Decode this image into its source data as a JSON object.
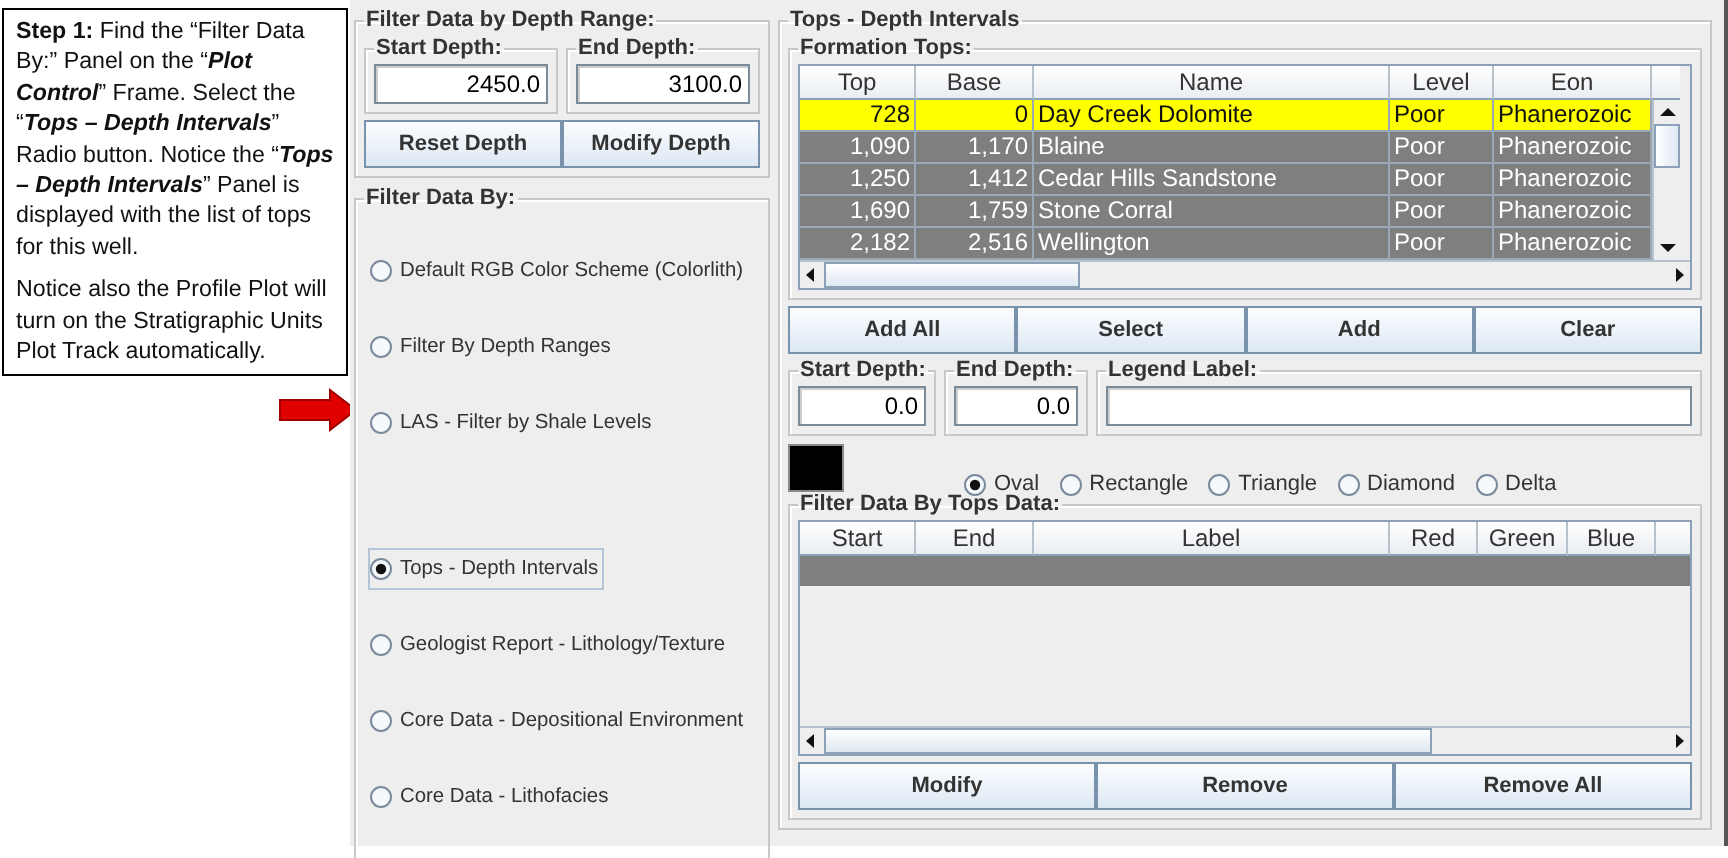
{
  "callout": {
    "paragraphs": [
      "**Step 1:** Find the “Filter Data  By:” Panel  on the “*Plot Control*” Frame. Select the “*Tops – Depth Intervals*” Radio button. Notice the “*Tops – Depth Intervals*”  Panel is displayed with the list of tops for this well.",
      "Notice also the Profile Plot will  turn on the Stratigraphic Units Plot Track automatically."
    ]
  },
  "depth_range": {
    "title": "Filter Data by Depth Range:",
    "start": {
      "label": "Start Depth:",
      "value": "2450.0"
    },
    "end": {
      "label": "End Depth:",
      "value": "3100.0"
    },
    "buttons": [
      "Reset Depth",
      "Modify Depth"
    ]
  },
  "filter_by": {
    "title": "Filter Data By:",
    "options": [
      {
        "label": "Default RGB Color Scheme (Colorlith)",
        "selected": false
      },
      {
        "label": "Filter By Depth Ranges",
        "selected": false
      },
      {
        "label": "LAS - Filter by Shale Levels",
        "selected": false
      },
      {
        "label": "Tops - Depth Intervals",
        "selected": true
      },
      {
        "label": "Geologist Report - Lithology/Texture",
        "selected": false
      },
      {
        "label": "Core Data - Depositional Environment",
        "selected": false
      },
      {
        "label": "Core Data - Lithofacies",
        "selected": false
      }
    ]
  },
  "tops_panel": {
    "title": "Tops - Depth Intervals",
    "formation_tops": {
      "title": "Formation Tops:",
      "columns": [
        "Top",
        "Base",
        "Name",
        "Level",
        "Eon"
      ],
      "rows": [
        {
          "cells": [
            "728",
            "0",
            "Day Creek Dolomite",
            "Poor",
            "Phanerozoic"
          ],
          "highlighted": true
        },
        {
          "cells": [
            "1,090",
            "1,170",
            "Blaine",
            "Poor",
            "Phanerozoic"
          ],
          "highlighted": false
        },
        {
          "cells": [
            "1,250",
            "1,412",
            "Cedar Hills Sandstone",
            "Poor",
            "Phanerozoic"
          ],
          "highlighted": false
        },
        {
          "cells": [
            "1,690",
            "1,759",
            "Stone Corral",
            "Poor",
            "Phanerozoic"
          ],
          "highlighted": false
        },
        {
          "cells": [
            "2,182",
            "2,516",
            "Wellington",
            "Poor",
            "Phanerozoic"
          ],
          "highlighted": false
        }
      ]
    },
    "buttons": [
      "Add All",
      "Select",
      "Add",
      "Clear"
    ],
    "start": {
      "label": "Start Depth:",
      "value": "0.0"
    },
    "end": {
      "label": "End Depth:",
      "value": "0.0"
    },
    "legend": {
      "label": "Legend Label:",
      "color": "#000000"
    },
    "shapes": [
      {
        "label": "Oval",
        "selected": true
      },
      {
        "label": "Rectangle",
        "selected": false
      },
      {
        "label": "Triangle",
        "selected": false
      },
      {
        "label": "Diamond",
        "selected": false
      },
      {
        "label": "Delta",
        "selected": false
      }
    ],
    "tops_data": {
      "title": "Filter Data By Tops Data:",
      "columns": [
        "Start",
        "End",
        "Label",
        "Red",
        "Green",
        "Blue"
      ]
    },
    "bottom_buttons": [
      "Modify",
      "Remove",
      "Remove All"
    ]
  }
}
